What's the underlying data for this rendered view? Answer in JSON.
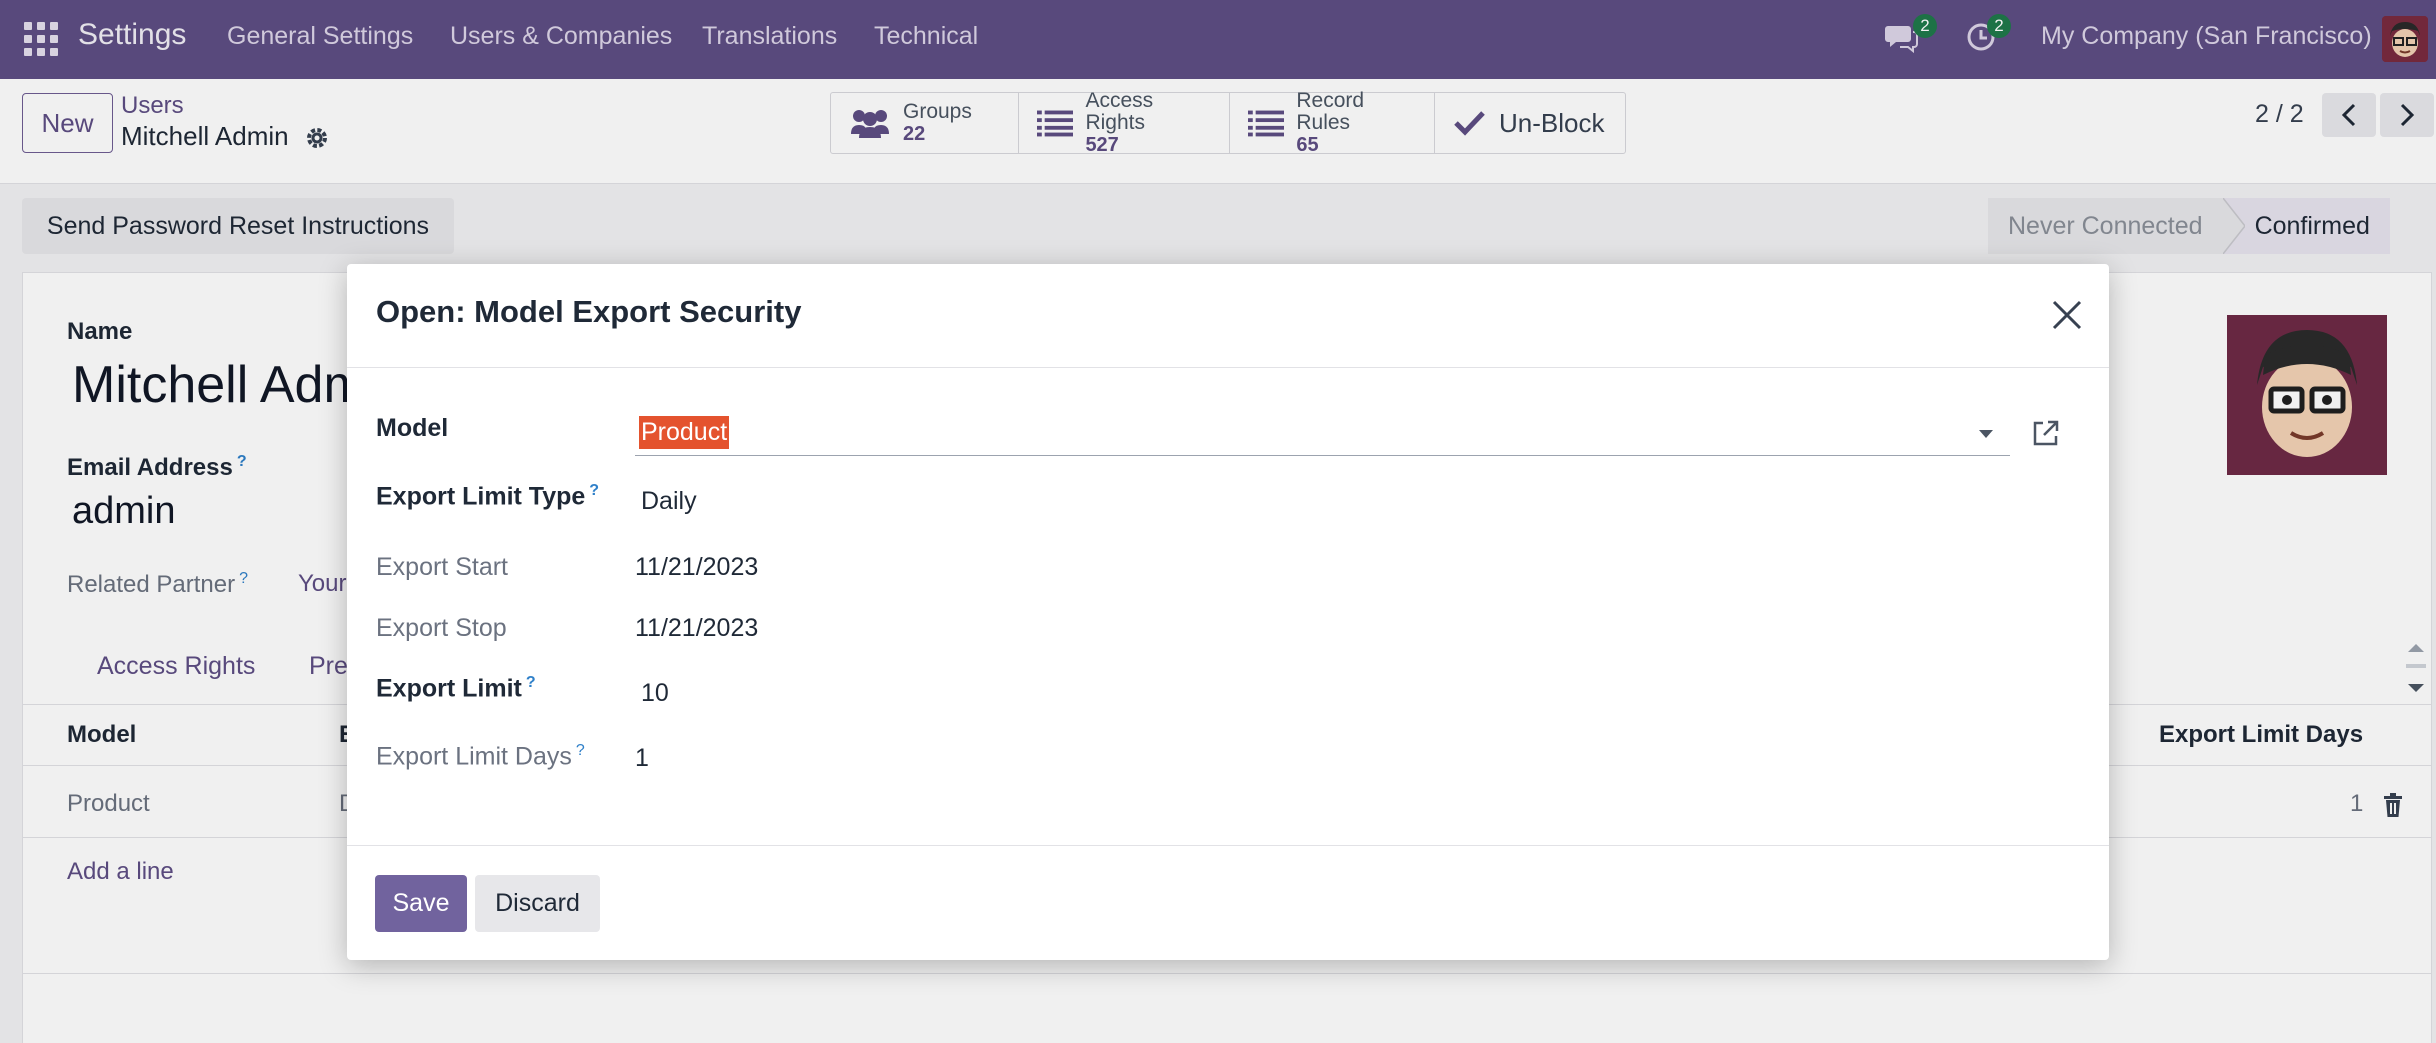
{
  "navbar": {
    "app_name": "Settings",
    "menu": [
      "General Settings",
      "Users & Companies",
      "Translations",
      "Technical"
    ],
    "messages_count": "2",
    "activities_count": "2",
    "company": "My Company (San Francisco)"
  },
  "control_panel": {
    "new_label": "New",
    "breadcrumb_parent": "Users",
    "breadcrumb_current": "Mitchell Admin",
    "smart_buttons": [
      {
        "label": "Groups",
        "count": "22",
        "icon": "users-icon"
      },
      {
        "label": "Access Rights",
        "count": "527",
        "icon": "list-icon"
      },
      {
        "label": "Record Rules",
        "count": "65",
        "icon": "list-icon"
      },
      {
        "label": "Un-Block",
        "icon": "check-icon"
      }
    ],
    "pager": "2 / 2"
  },
  "form": {
    "reset_button": "Send Password Reset Instructions",
    "status_never": "Never Connected",
    "status_confirmed": "Confirmed",
    "name_label": "Name",
    "name_value": "Mitchell Adm",
    "email_label": "Email Address",
    "email_help": "?",
    "email_value": "admin",
    "partner_label": "Related Partner",
    "partner_help": "?",
    "partner_value": "Your",
    "tabs": [
      "Access Rights",
      "Pre"
    ],
    "table": {
      "headers": [
        "Model",
        "E",
        "Export Limit Days"
      ],
      "row": {
        "model": "Product",
        "type": "D",
        "days": "1"
      },
      "add_line": "Add a line"
    }
  },
  "modal": {
    "title": "Open: Model Export Security",
    "fields": {
      "model_label": "Model",
      "model_value": "Product",
      "limit_type_label": "Export Limit Type",
      "limit_type_value": "Daily",
      "start_label": "Export Start",
      "start_value": "11/21/2023",
      "stop_label": "Export Stop",
      "stop_value": "11/21/2023",
      "limit_label": "Export Limit",
      "limit_value": "10",
      "days_label": "Export Limit Days",
      "days_value": "1",
      "help": "?"
    },
    "save_label": "Save",
    "discard_label": "Discard"
  }
}
